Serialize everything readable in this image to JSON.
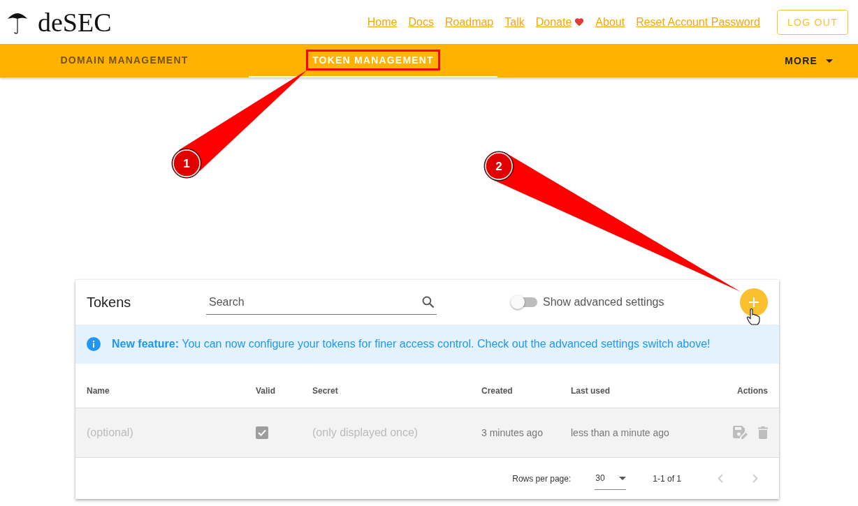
{
  "brand": {
    "name": "deSEC"
  },
  "links": [
    {
      "label": "Home"
    },
    {
      "label": "Docs"
    },
    {
      "label": "Roadmap"
    },
    {
      "label": "Talk"
    },
    {
      "label": "Donate",
      "kind": "heart"
    },
    {
      "label": "About"
    },
    {
      "label": "Reset Account Password"
    }
  ],
  "logout": "LOG OUT",
  "tabs": [
    {
      "label": "DOMAIN MANAGEMENT",
      "selected": false,
      "highlighted": false
    },
    {
      "label": "TOKEN MANAGEMENT",
      "selected": true,
      "highlighted": true
    }
  ],
  "more": {
    "label": "MORE"
  },
  "card": {
    "title": "Tokens",
    "search": {
      "placeholder": "Search"
    },
    "advanced": {
      "label": "Show advanced settings",
      "on": false
    },
    "notice": {
      "text": "**New feature:** You can now configure your tokens for finer access control. Check out the advanced settings switch above!"
    },
    "columns": [
      "Name",
      "Valid",
      "Secret",
      "Created",
      "Last used",
      "Actions"
    ],
    "rows": [
      {
        "name_placeholder": "(optional)",
        "valid": true,
        "secret_placeholder": "(only displayed once)",
        "created": "3 minutes ago",
        "last_used": "less than a minute ago"
      }
    ],
    "footer": {
      "rows_per_page_label": "Rows per page:",
      "rows_per_page": "30",
      "range": "1-1 of 1"
    }
  },
  "annotations": [
    {
      "label": "1"
    },
    {
      "label": "2"
    }
  ]
}
